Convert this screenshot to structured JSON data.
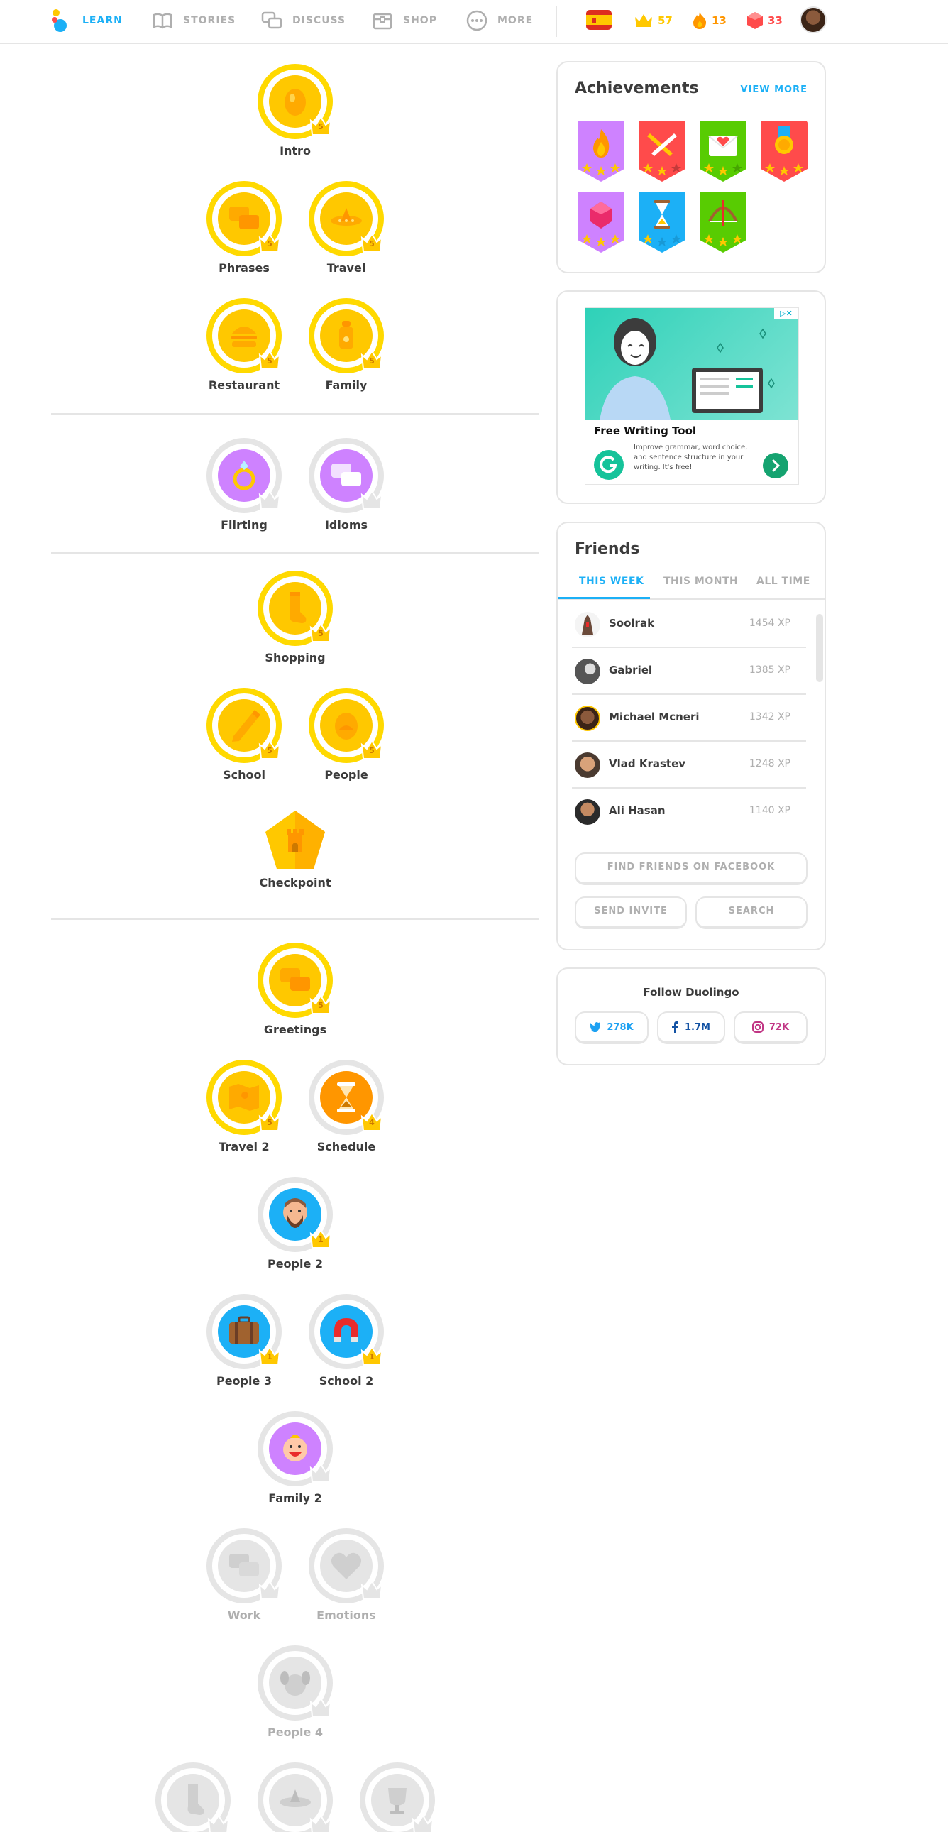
{
  "nav": {
    "items": [
      {
        "label": "LEARN",
        "icon": "learn-logo-icon"
      },
      {
        "label": "STORIES",
        "icon": "book-icon"
      },
      {
        "label": "DISCUSS",
        "icon": "chat-bubbles-icon"
      },
      {
        "label": "SHOP",
        "icon": "shop-chest-icon"
      },
      {
        "label": "MORE",
        "icon": "ellipsis-icon"
      }
    ],
    "language_flag": "spain-flag-icon",
    "crowns": "57",
    "streak": "13",
    "gems": "33",
    "colors": {
      "active": "#1cb0f6",
      "inactive": "#afafaf",
      "crown": "#ffc800",
      "streak": "#ff9600",
      "gem": "#ff4b4b"
    }
  },
  "tree": {
    "rows": [
      [
        {
          "label": "Intro",
          "crown": "5",
          "state": "gold",
          "icon": "egg-icon"
        }
      ],
      [
        {
          "label": "Phrases",
          "crown": "5",
          "state": "gold",
          "icon": "speech-bubbles-icon"
        },
        {
          "label": "Travel",
          "crown": "5",
          "state": "gold",
          "icon": "plane-icon"
        }
      ],
      [
        {
          "label": "Restaurant",
          "crown": "5",
          "state": "gold",
          "icon": "burger-icon"
        },
        {
          "label": "Family",
          "crown": "5",
          "state": "gold",
          "icon": "baby-bottle-icon"
        }
      ],
      [
        {
          "label": "Flirting",
          "crown": "",
          "state": "purple",
          "icon": "ring-icon"
        },
        {
          "label": "Idioms",
          "crown": "",
          "state": "purple",
          "icon": "speech-bubbles-icon"
        }
      ],
      [
        {
          "label": "Shopping",
          "crown": "5",
          "state": "gold",
          "icon": "sock-icon"
        }
      ],
      [
        {
          "label": "School",
          "crown": "5",
          "state": "gold",
          "icon": "pencil-icon"
        },
        {
          "label": "People",
          "crown": "5",
          "state": "gold",
          "icon": "egg-icon"
        }
      ],
      [
        {
          "label": "Greetings",
          "crown": "5",
          "state": "gold",
          "icon": "speech-bubbles-icon"
        }
      ],
      [
        {
          "label": "Travel 2",
          "crown": "5",
          "state": "gold",
          "icon": "map-icon"
        },
        {
          "label": "Schedule",
          "crown": "4",
          "state": "orange",
          "icon": "hourglass-icon"
        }
      ],
      [
        {
          "label": "People 2",
          "crown": "1",
          "state": "blue",
          "icon": "bearded-man-icon"
        }
      ],
      [
        {
          "label": "People 3",
          "crown": "1",
          "state": "blue",
          "icon": "suitcase-icon"
        },
        {
          "label": "School 2",
          "crown": "1",
          "state": "blue",
          "icon": "magnet-icon"
        }
      ],
      [
        {
          "label": "Family 2",
          "crown": "",
          "state": "purple",
          "icon": "baby-face-icon"
        }
      ],
      [
        {
          "label": "Work",
          "crown": "",
          "state": "locked",
          "icon": "speech-bubbles-icon"
        },
        {
          "label": "Emotions",
          "crown": "",
          "state": "locked",
          "icon": "heart-icon"
        }
      ],
      [
        {
          "label": "People 4",
          "crown": "",
          "state": "locked",
          "icon": "dog-icon"
        }
      ],
      [
        {
          "label": "",
          "crown": "",
          "state": "locked",
          "icon": "sock-icon"
        },
        {
          "label": "",
          "crown": "",
          "state": "locked",
          "icon": "plane-icon"
        },
        {
          "label": "",
          "crown": "",
          "state": "locked",
          "icon": "trophy-icon"
        }
      ]
    ],
    "checkpoint": {
      "label": "Checkpoint",
      "icon": "castle-icon"
    }
  },
  "achievements": {
    "title": "Achievements",
    "view_more": "VIEW MORE",
    "badges": [
      {
        "name": "wildfire-badge",
        "color": "#ce82ff",
        "stars": 3
      },
      {
        "name": "sage-badge",
        "color": "#ff4b4b",
        "stars": 2
      },
      {
        "name": "friendly-badge",
        "color": "#58cc02",
        "stars": 2
      },
      {
        "name": "champion-badge",
        "color": "#ff4b4b",
        "stars": 3
      },
      {
        "name": "regal-badge",
        "color": "#ce82ff",
        "stars": 3
      },
      {
        "name": "photogenic-badge",
        "color": "#1cb0f6",
        "stars": 1
      },
      {
        "name": "sharpshooter-badge",
        "color": "#58cc02",
        "stars": 3
      }
    ]
  },
  "ad": {
    "title": "Free Writing Tool",
    "text": "Improve grammar, word choice, and sentence structure in your writing. It's free!",
    "close": "▷✕"
  },
  "friends": {
    "title": "Friends",
    "tabs": [
      "THIS WEEK",
      "THIS MONTH",
      "ALL TIME"
    ],
    "list": [
      {
        "name": "Soolrak",
        "xp": "1454 XP"
      },
      {
        "name": "Gabriel",
        "xp": "1385 XP"
      },
      {
        "name": "Michael Mcneri",
        "xp": "1342 XP"
      },
      {
        "name": "Vlad Krastev",
        "xp": "1248 XP"
      },
      {
        "name": "Ali Hasan",
        "xp": "1140 XP"
      }
    ],
    "find_facebook": "FIND FRIENDS ON FACEBOOK",
    "send_invite": "SEND INVITE",
    "search": "SEARCH"
  },
  "follow": {
    "title": "Follow Duolingo",
    "twitter": "278K",
    "facebook": "1.7M",
    "instagram": "72K",
    "colors": {
      "twitter": "#1da1f2",
      "facebook": "#1453a4",
      "instagram": "#c13584"
    }
  }
}
